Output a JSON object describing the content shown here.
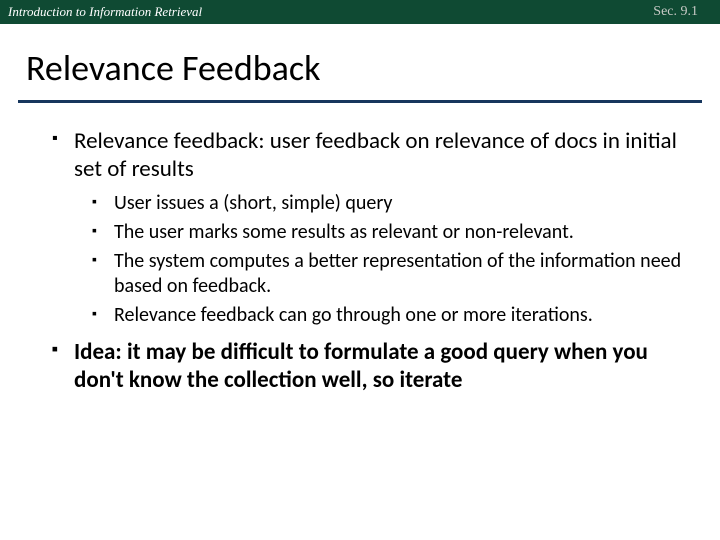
{
  "topbar": {
    "left": "Introduction to Information Retrieval",
    "right": "Sec. 9.1"
  },
  "title": "Relevance Feedback",
  "bullets": {
    "b1": "Relevance feedback: user feedback on relevance of docs in initial set of results",
    "b1_sub": {
      "s1": "User issues a (short, simple) query",
      "s2": "The user marks some results as relevant or non-relevant.",
      "s3": "The system computes a better representation of the information need based on feedback.",
      "s4": "Relevance feedback can go through one or more iterations."
    },
    "b2": "Idea: it may be difficult to formulate a good query when you don't know the collection well, so iterate"
  }
}
